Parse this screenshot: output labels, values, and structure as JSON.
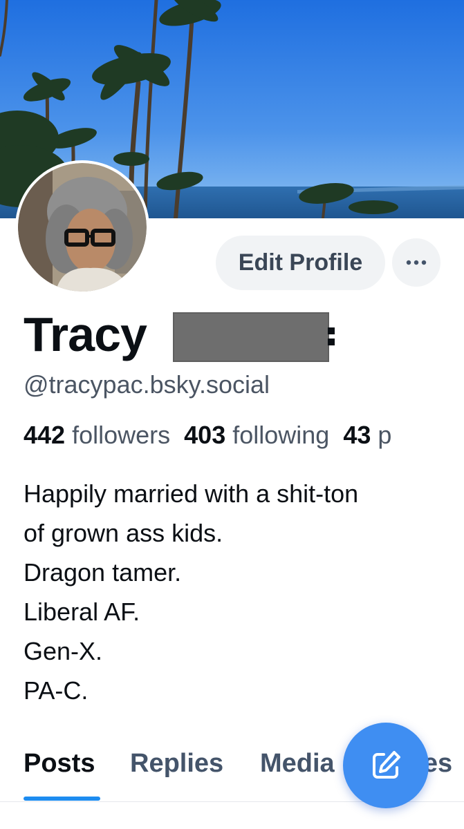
{
  "profile": {
    "display_name_visible": "Tracy",
    "handle": "@tracypac.bsky.social",
    "edit_label": "Edit Profile"
  },
  "stats": {
    "followers_count": "442",
    "followers_label": "followers",
    "following_count": "403",
    "following_label": "following",
    "posts_count": "43"
  },
  "bio": {
    "lines": [
      "Happily married with a shit-ton",
      "of grown ass kids.",
      "Dragon tamer.",
      "Liberal AF.",
      "Gen-X.",
      "PA-C."
    ]
  },
  "tabs": [
    {
      "label": "Posts",
      "active": true
    },
    {
      "label": "Replies",
      "active": false
    },
    {
      "label": "Media",
      "active": false
    },
    {
      "label": "Likes",
      "active": false
    }
  ],
  "icons": {
    "more": "ellipsis-icon",
    "compose": "compose-icon"
  },
  "colors": {
    "accent": "#1d8cf0",
    "fab": "#3f8ef2",
    "secondary_text": "#4b5563",
    "button_bg": "#f1f3f5"
  }
}
